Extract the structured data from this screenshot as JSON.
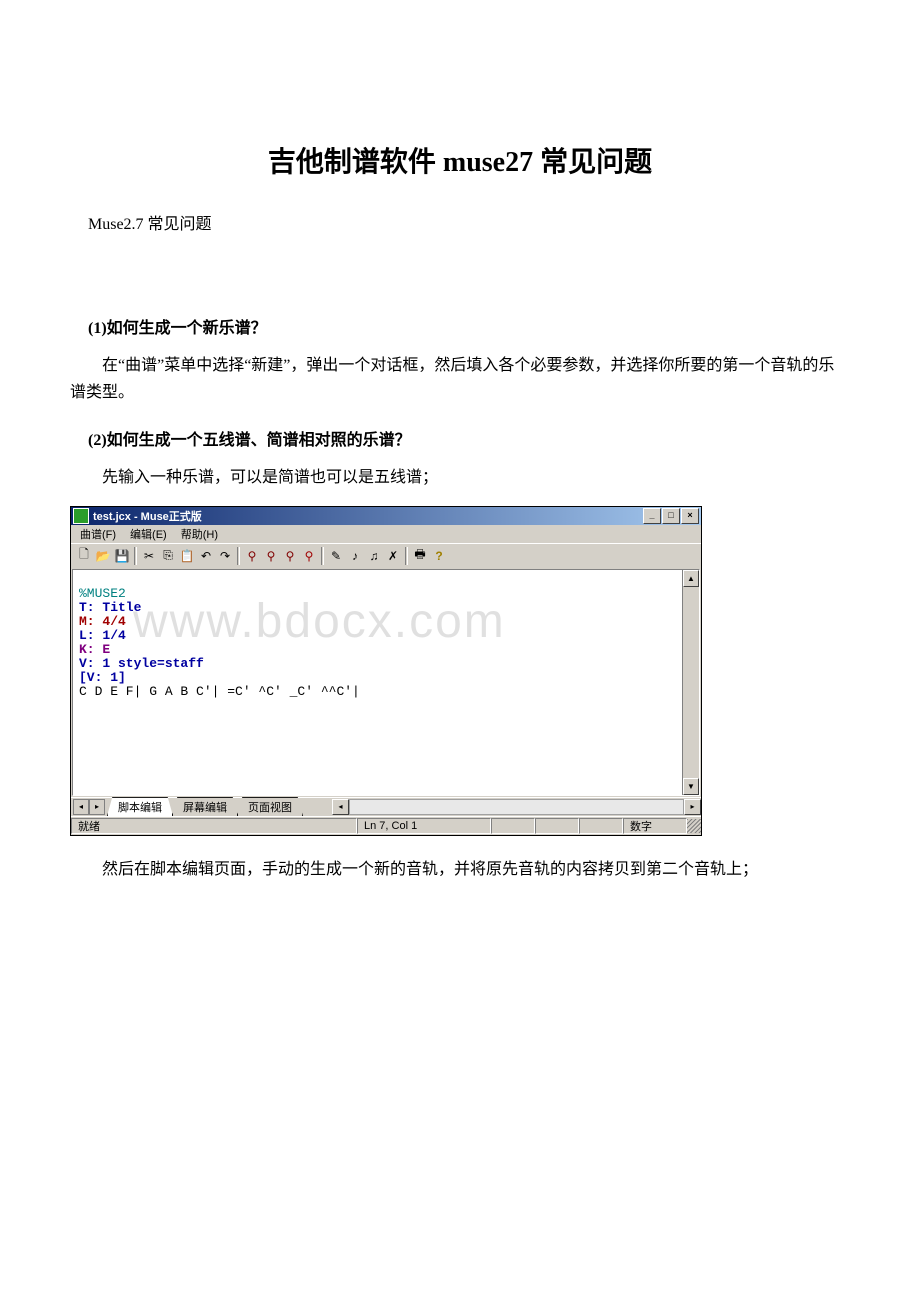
{
  "title": "吉他制谱软件 muse27 常见问题",
  "subtitle": "Muse2.7 常见问题",
  "questions": {
    "q1": {
      "heading": "(1)如何生成一个新乐谱？",
      "answer": "在“曲谱”菜单中选择“新建”，弹出一个对话框，然后填入各个必要参数，并选择你所要的第一个音轨的乐谱类型。"
    },
    "q2": {
      "heading": "(2)如何生成一个五线谱、简谱相对照的乐谱？",
      "answer_before": "先输入一种乐谱，可以是简谱也可以是五线谱；",
      "answer_after": "然后在脚本编辑页面，手动的生成一个新的音轨，并将原先音轨的内容拷贝到第二个音轨上；"
    }
  },
  "window": {
    "title": "test.jcx - Muse正式版",
    "menus": {
      "file": "曲谱(F)",
      "edit": "编辑(E)",
      "help": "帮助(H)"
    },
    "toolbar_icons": [
      "new-icon",
      "open-icon",
      "save-icon",
      "sep",
      "cut-icon",
      "copy-icon",
      "paste-icon",
      "undo-icon",
      "redo-icon",
      "sep",
      "find-icon",
      "find-next-up-icon",
      "find-next-down-icon",
      "replace-icon",
      "sep",
      "pencil-icon",
      "note-icon",
      "note2-icon",
      "eraser-icon",
      "sep",
      "print-icon",
      "help-icon"
    ],
    "code": {
      "l1": "%MUSE2",
      "l2": "T: Title",
      "l3": "M: 4/4",
      "l4": "L: 1/4",
      "l5": "K: E",
      "l6": "V: 1 style=staff",
      "l7": "[V: 1]",
      "l8": "C D E F| G A B C'| =C' ^C' _C' ^^C'|"
    },
    "watermark": "www.bdocx.com",
    "tabs": {
      "script": "脚本编辑",
      "screen": "屏幕编辑",
      "page": "页面视图"
    },
    "status": {
      "ready": "就绪",
      "position": "Ln 7, Col 1",
      "mode": "数字"
    }
  }
}
